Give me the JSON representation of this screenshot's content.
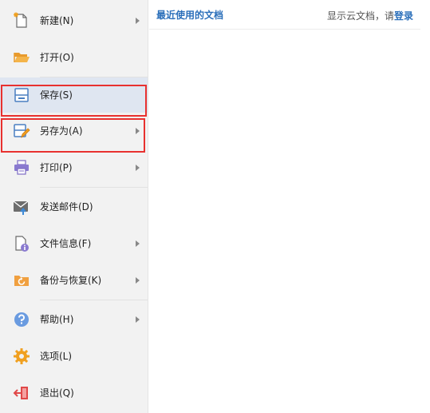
{
  "menu": {
    "items": [
      {
        "label": "新建(N)",
        "icon": "new-document-icon",
        "has_submenu": true
      },
      {
        "label": "打开(O)",
        "icon": "folder-open-icon",
        "has_submenu": false
      },
      {
        "label": "保存(S)",
        "icon": "save-icon",
        "has_submenu": false,
        "selected": true
      },
      {
        "label": "另存为(A)",
        "icon": "save-as-icon",
        "has_submenu": true
      },
      {
        "label": "打印(P)",
        "icon": "printer-icon",
        "has_submenu": true
      },
      {
        "label": "发送邮件(D)",
        "icon": "mail-icon",
        "has_submenu": false
      },
      {
        "label": "文件信息(F)",
        "icon": "file-info-icon",
        "has_submenu": true
      },
      {
        "label": "备份与恢复(K)",
        "icon": "backup-restore-icon",
        "has_submenu": true
      },
      {
        "label": "帮助(H)",
        "icon": "help-icon",
        "has_submenu": true
      },
      {
        "label": "选项(L)",
        "icon": "gear-icon",
        "has_submenu": false
      },
      {
        "label": "退出(Q)",
        "icon": "exit-icon",
        "has_submenu": false
      }
    ]
  },
  "main": {
    "recent_title": "最近使用的文档",
    "cloud_prefix": "显示云文档，请",
    "login_label": "登录"
  },
  "colors": {
    "accent": "#2b6fba",
    "highlight_border": "#e8312f",
    "selected_bg": "#dfe6f1",
    "sidebar_bg": "#f2f2f2"
  }
}
